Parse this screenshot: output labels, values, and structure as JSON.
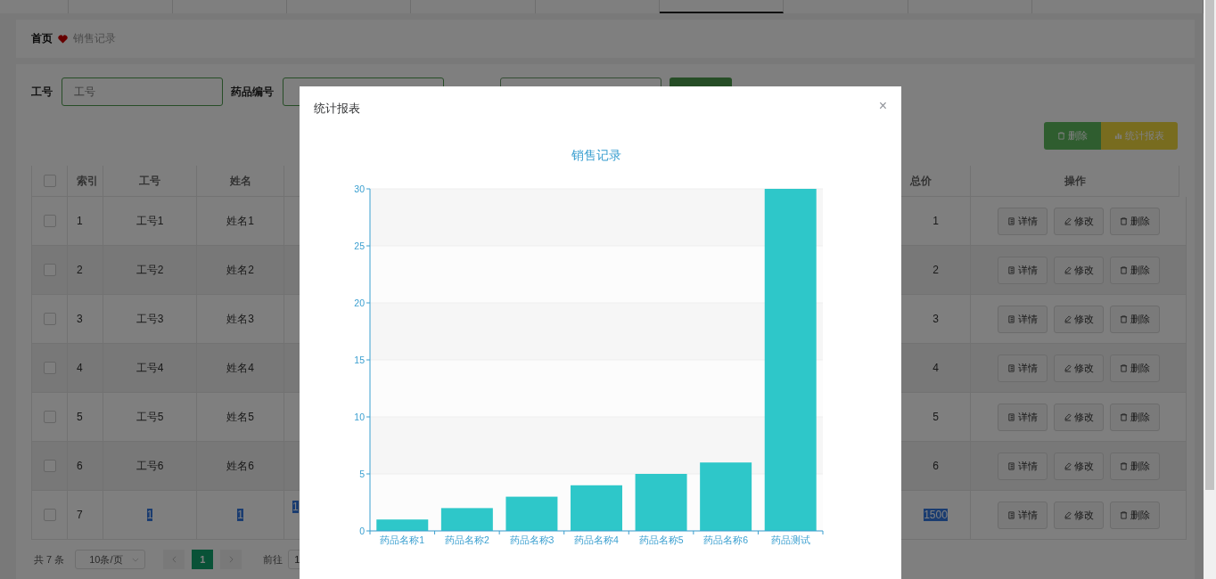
{
  "top_tabs": [
    {
      "selected": false
    },
    {
      "selected": false
    },
    {
      "selected": false
    },
    {
      "selected": false
    },
    {
      "selected": false
    },
    {
      "selected": false
    },
    {
      "selected": true
    },
    {
      "selected": false
    },
    {
      "selected": false
    },
    {
      "selected": false
    }
  ],
  "breadcrumb": [
    {
      "label": "首页",
      "current": false
    },
    {
      "label": "销售记录",
      "current": true
    }
  ],
  "search_form": {
    "fields": [
      {
        "kind": "labeled",
        "label": "工号",
        "placeholder": "工号"
      },
      {
        "kind": "labeled",
        "label": "药品编号"
      },
      {
        "kind": "bare"
      }
    ]
  },
  "actions": [
    {
      "label": "删除",
      "kind": "delete"
    },
    {
      "label": "统计报表",
      "kind": "report"
    }
  ],
  "table": {
    "select_all_checked": false,
    "columns": [
      "索引",
      "工号",
      "姓名",
      "总价",
      "操作"
    ],
    "rows": [
      {
        "checked": false,
        "index": "1",
        "emp_no": "工号1",
        "name": "姓名1",
        "total": "1",
        "text_selected": false,
        "actions": [
          "详情",
          "修改",
          "删除"
        ]
      },
      {
        "checked": false,
        "index": "2",
        "emp_no": "工号2",
        "name": "姓名2",
        "total": "2",
        "text_selected": false,
        "actions": [
          "详情",
          "修改",
          "删除"
        ]
      },
      {
        "checked": false,
        "index": "3",
        "emp_no": "工号3",
        "name": "姓名3",
        "total": "3",
        "text_selected": false,
        "actions": [
          "详情",
          "修改",
          "删除"
        ]
      },
      {
        "checked": false,
        "index": "4",
        "emp_no": "工号4",
        "name": "姓名4",
        "total": "4",
        "text_selected": false,
        "actions": [
          "详情",
          "修改",
          "删除"
        ]
      },
      {
        "checked": false,
        "index": "5",
        "emp_no": "工号5",
        "name": "姓名5",
        "total": "5",
        "text_selected": false,
        "actions": [
          "详情",
          "修改",
          "删除"
        ]
      },
      {
        "checked": false,
        "index": "6",
        "emp_no": "工号6",
        "name": "姓名6",
        "total": "6",
        "text_selected": false,
        "actions": [
          "详情",
          "修改",
          "删除"
        ]
      },
      {
        "checked": false,
        "index": "7",
        "emp_no": "1",
        "name": "1",
        "column_4": "1",
        "total": "1500",
        "text_selected": true,
        "actions": [
          "详情",
          "修改",
          "删除"
        ]
      }
    ]
  },
  "pagination": {
    "total": "共 7 条",
    "page_size": "10条/页",
    "pages": [
      {
        "label": "1",
        "selected": true
      }
    ],
    "goto_label": "前往",
    "goto_value": "1"
  },
  "dialog": {
    "title": "统计报表",
    "close": "×",
    "chart_data": {
      "type": "bar",
      "title": "销售记录",
      "categories": [
        "药品名称1",
        "药品名称2",
        "药品名称3",
        "药品名称4",
        "药品名称5",
        "药品名称6",
        "药品测试"
      ],
      "series": [
        {
          "color": "#2ec7c9",
          "values": [
            1,
            2,
            3,
            4,
            5,
            6,
            30
          ]
        }
      ],
      "grid": true,
      "ylim": [
        0,
        30
      ],
      "yticks": [
        0,
        5,
        10,
        15,
        20,
        25,
        30
      ]
    }
  }
}
